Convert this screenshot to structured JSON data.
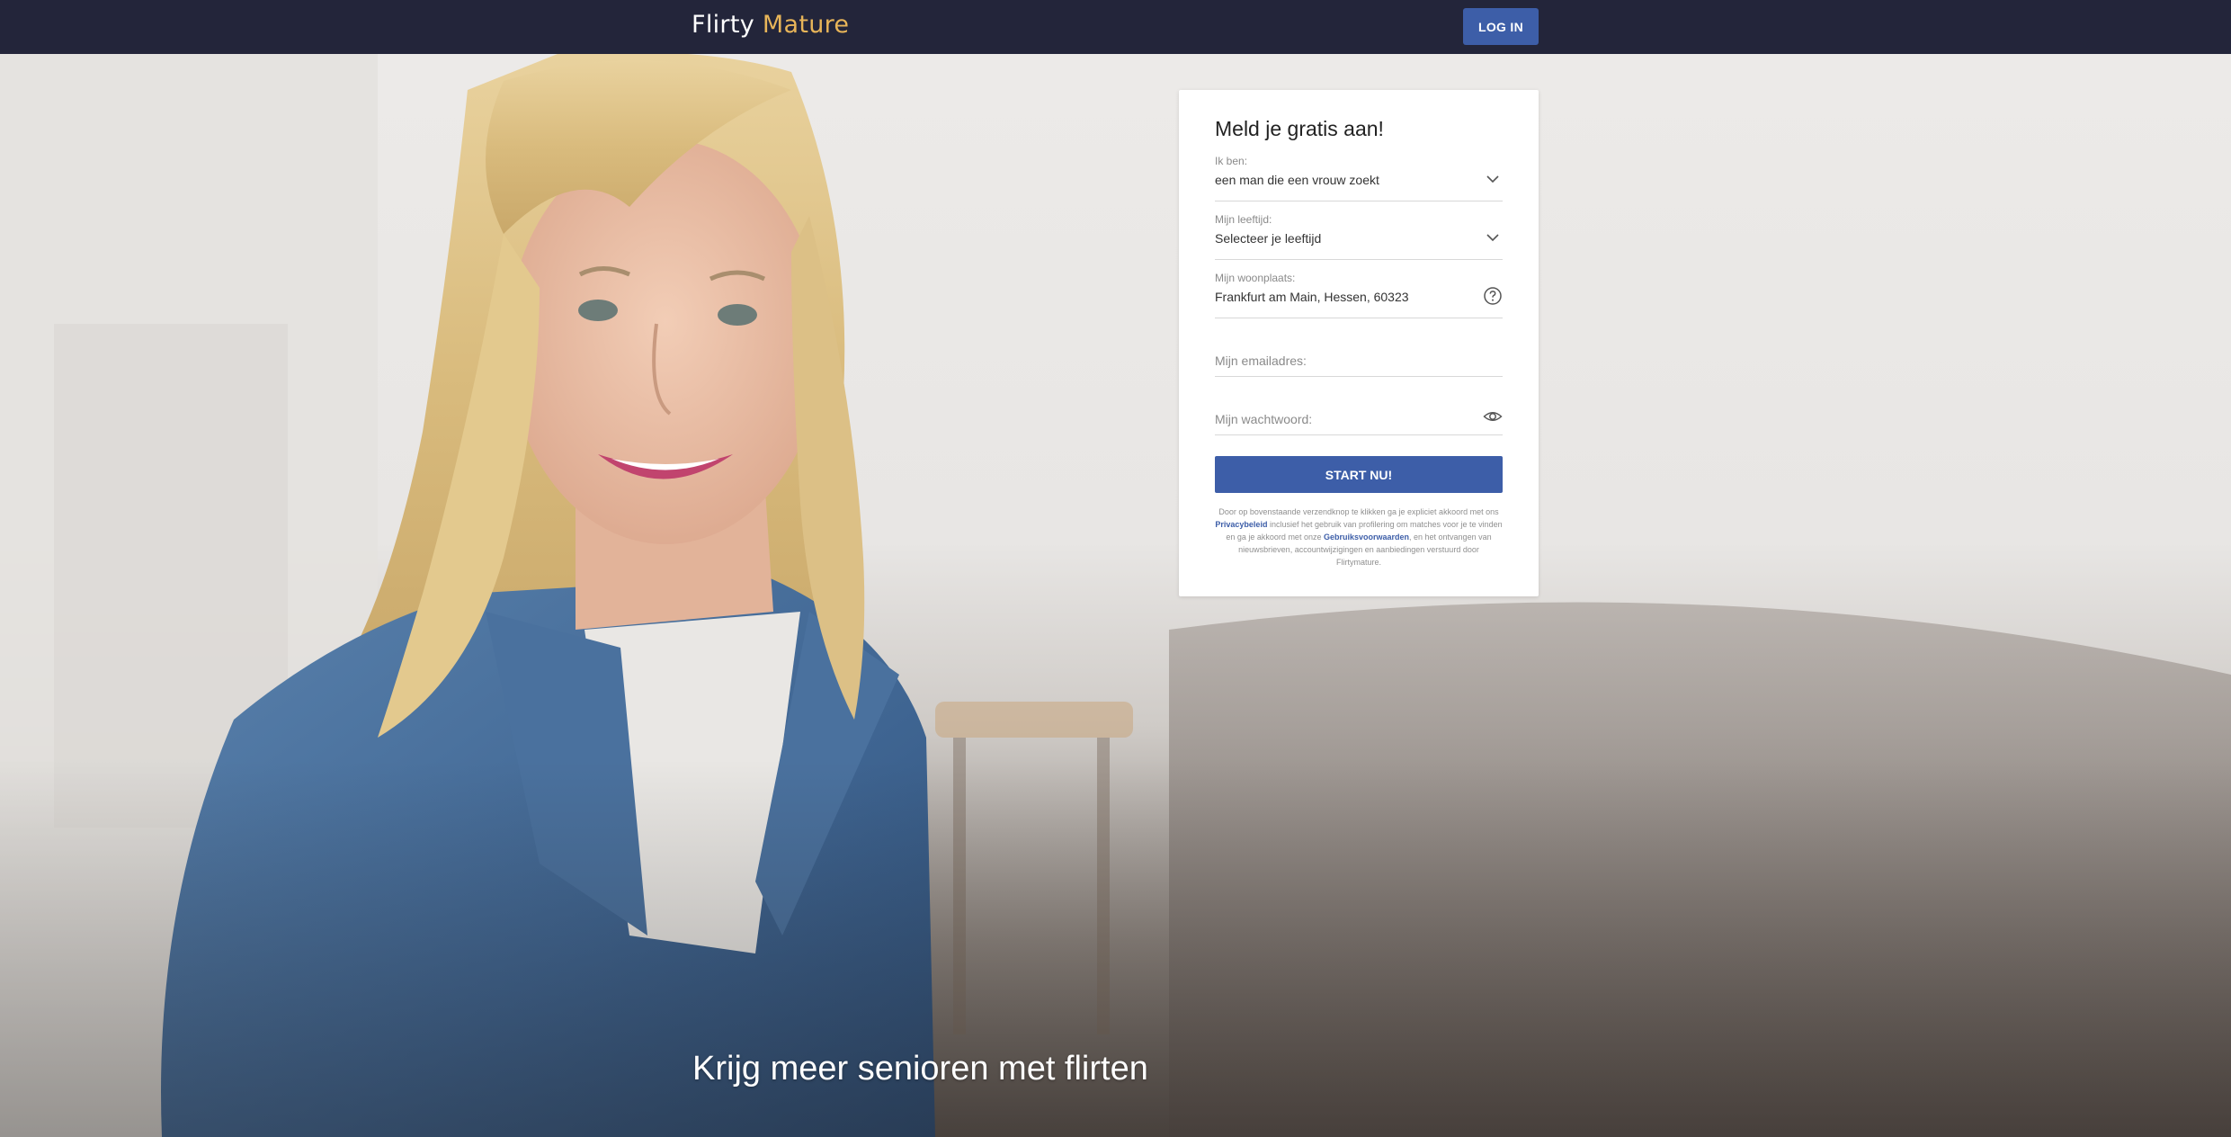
{
  "brand": {
    "logo_part1": "Flirty ",
    "logo_part2": "Mature",
    "accent_color": "#e8b559",
    "primary_color": "#3d5ea8",
    "topbar_color": "#23253a"
  },
  "header": {
    "login_label": "LOG IN"
  },
  "signup": {
    "title": "Meld je gratis aan!",
    "fields": {
      "gender": {
        "label": "Ik ben:",
        "value": "een man die een vrouw zoekt",
        "icon": "chevron-down-icon"
      },
      "age": {
        "label": "Mijn leeftijd:",
        "value": "Selecteer je leeftijd",
        "icon": "chevron-down-icon"
      },
      "location": {
        "label": "Mijn woonplaats:",
        "value": "Frankfurt am Main, Hessen, 60323",
        "icon": "help-icon"
      },
      "email": {
        "placeholder": "Mijn emailadres:"
      },
      "password": {
        "placeholder": "Mijn wachtwoord:",
        "icon": "eye-icon"
      }
    },
    "submit_label": "START NU!",
    "legal": {
      "text1": "Door op bovenstaande verzendknop te klikken ga je expliciet akkoord met ons ",
      "privacy_link": "Privacybeleid",
      "text2": " inclusief het gebruik van profilering om matches voor je te vinden en ga je akkoord met onze ",
      "terms_link": "Gebruiksvoorwaarden",
      "text3": ", en het ontvangen van nieuwsbrieven, accountwijzigingen en aanbiedingen verstuurd door Flirtymature."
    }
  },
  "hero": {
    "tagline": "Krijg meer senioren met flirten",
    "image": "smiling-mature-woman-photo"
  }
}
